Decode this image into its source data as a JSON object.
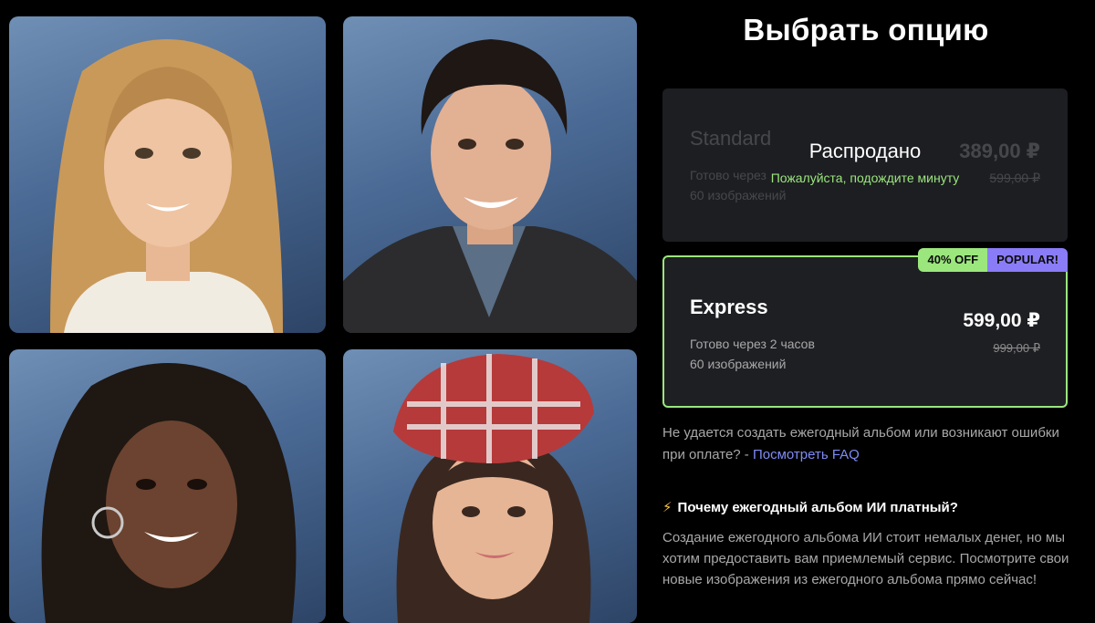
{
  "photos": [
    {
      "name": "portrait-blonde-girl"
    },
    {
      "name": "portrait-dark-hair-guy"
    },
    {
      "name": "portrait-curly-hair-girl"
    },
    {
      "name": "portrait-beret-girl"
    }
  ],
  "header": {
    "title": "Выбрать опцию"
  },
  "standard": {
    "name": "Standard",
    "price": "389,00 ₽",
    "old_price": "599,00 ₽",
    "delivery": "Готово через",
    "images": "60 изображений",
    "status": "Распродано",
    "status_note": "Пожалуйста, подождите минуту"
  },
  "express": {
    "badge_off": "40% OFF",
    "badge_popular": "POPULAR!",
    "name": "Express",
    "price": "599,00 ₽",
    "old_price": "999,00 ₽",
    "delivery": "Готово через 2 часов",
    "images": "60 изображений"
  },
  "faq": {
    "text": "Не удается создать ежегодный альбом или возникают ошибки при оплате? - ",
    "link": "Посмотреть FAQ"
  },
  "why": {
    "icon": "⚡",
    "title": "Почему ежегодный альбом ИИ платный?",
    "text": "Создание ежегодного альбома ИИ стоит немалых денег, но мы хотим предоставить вам приемлемый сервис. Посмотрите свои новые изображения из ежегодного альбома прямо сейчас!"
  },
  "colors": {
    "accent_green": "#9be77d",
    "accent_purple": "#8a7cf7",
    "link": "#7f8cf5"
  }
}
